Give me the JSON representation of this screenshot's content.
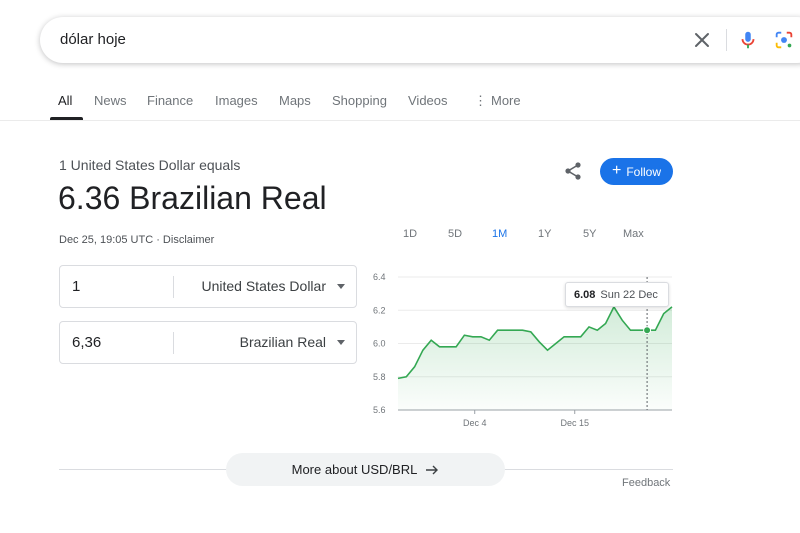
{
  "search": {
    "query": "dólar hoje"
  },
  "tabs": [
    {
      "label": "All"
    },
    {
      "label": "News"
    },
    {
      "label": "Finance"
    },
    {
      "label": "Images"
    },
    {
      "label": "Maps"
    },
    {
      "label": "Shopping"
    },
    {
      "label": "Videos"
    },
    {
      "label": "More"
    }
  ],
  "result": {
    "equals_text": "1 United States Dollar equals",
    "value_text": "6.36 Brazilian Real",
    "timestamp": "Dec 25, 19:05 UTC · Disclaimer",
    "follow_label": "Follow"
  },
  "converter": {
    "from_amount": "1",
    "from_currency": "United States Dollar",
    "to_amount": "6,36",
    "to_currency": "Brazilian Real"
  },
  "ranges": [
    {
      "label": "1D"
    },
    {
      "label": "5D"
    },
    {
      "label": "1M"
    },
    {
      "label": "1Y"
    },
    {
      "label": "5Y"
    },
    {
      "label": "Max"
    }
  ],
  "active_range": "1M",
  "tooltip": {
    "value": "6.08",
    "date": "Sun 22 Dec"
  },
  "footer": {
    "more_about": "More about USD/BRL",
    "feedback": "Feedback"
  },
  "colors": {
    "accent": "#1a73e8",
    "line": "#34a853"
  },
  "chart_data": {
    "type": "area",
    "y_ticks": [
      "6.4",
      "6.2",
      "6.0",
      "5.8",
      "5.6"
    ],
    "ylim": [
      5.6,
      6.4
    ],
    "x_tick_labels": [
      "Dec 4",
      "Dec 15"
    ],
    "x": [
      0,
      1,
      2,
      3,
      4,
      5,
      6,
      7,
      8,
      9,
      10,
      11,
      12,
      13,
      14,
      15,
      16,
      17,
      18,
      19,
      20,
      21,
      22,
      23,
      24,
      25,
      26,
      27,
      28,
      29,
      30,
      31,
      32,
      33,
      34,
      35,
      36,
      37,
      38,
      39,
      40
    ],
    "values": [
      5.79,
      5.8,
      5.86,
      5.96,
      6.02,
      5.98,
      5.98,
      5.98,
      6.05,
      6.04,
      6.04,
      6.02,
      6.08,
      6.08,
      6.08,
      6.08,
      6.07,
      6.01,
      5.96,
      6.0,
      6.04,
      6.04,
      6.04,
      6.1,
      6.08,
      6.12,
      6.22,
      6.14,
      6.08,
      6.08,
      6.08,
      6.08,
      6.18,
      6.22
    ]
  }
}
